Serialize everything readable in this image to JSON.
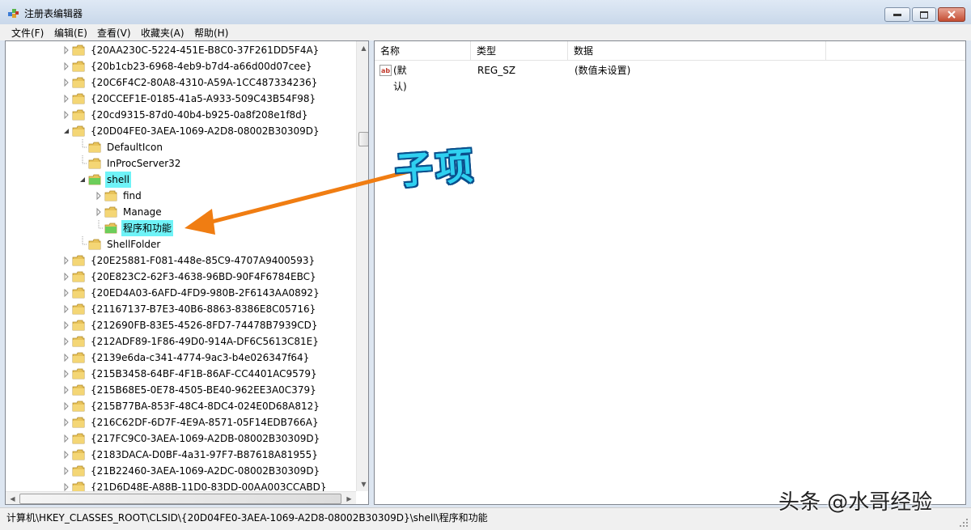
{
  "window": {
    "title": "注册表编辑器"
  },
  "menu": [
    {
      "id": "file",
      "label": "文件(F)"
    },
    {
      "id": "edit",
      "label": "编辑(E)"
    },
    {
      "id": "view",
      "label": "查看(V)"
    },
    {
      "id": "favorites",
      "label": "收藏夹(A)"
    },
    {
      "id": "help",
      "label": "帮助(H)"
    }
  ],
  "tree": [
    {
      "label": "{20AA230C-5224-451E-B8C0-37F261DD5F4A}",
      "expander": "collapsed"
    },
    {
      "label": "{20b1cb23-6968-4eb9-b7d4-a66d00d07cee}",
      "expander": "collapsed"
    },
    {
      "label": "{20C6F4C2-80A8-4310-A59A-1CC487334236}",
      "expander": "collapsed"
    },
    {
      "label": "{20CCEF1E-0185-41a5-A933-509C43B54F98}",
      "expander": "collapsed"
    },
    {
      "label": "{20cd9315-87d0-40b4-b925-0a8f208e1f8d}",
      "expander": "collapsed"
    },
    {
      "label": "{20D04FE0-3AEA-1069-A2D8-08002B30309D}",
      "expander": "expanded"
    },
    {
      "label": "DefaultIcon",
      "expander": "none",
      "level": 1
    },
    {
      "label": "InProcServer32",
      "expander": "none",
      "level": 1
    },
    {
      "label": "shell",
      "expander": "expanded",
      "level": 1,
      "highlight": true
    },
    {
      "label": "find",
      "expander": "collapsed",
      "level": 2
    },
    {
      "label": "Manage",
      "expander": "collapsed",
      "level": 2
    },
    {
      "label": "程序和功能",
      "expander": "none",
      "level": 2,
      "highlight": true,
      "selected": true
    },
    {
      "label": "ShellFolder",
      "expander": "none",
      "level": 1
    },
    {
      "label": "{20E25881-F081-448e-85C9-4707A9400593}",
      "expander": "collapsed"
    },
    {
      "label": "{20E823C2-62F3-4638-96BD-90F4F6784EBC}",
      "expander": "collapsed"
    },
    {
      "label": "{20ED4A03-6AFD-4FD9-980B-2F6143AA0892}",
      "expander": "collapsed"
    },
    {
      "label": "{21167137-B7E3-40B6-8863-8386E8C05716}",
      "expander": "collapsed"
    },
    {
      "label": "{212690FB-83E5-4526-8FD7-74478B7939CD}",
      "expander": "collapsed"
    },
    {
      "label": "{212ADF89-1F86-49D0-914A-DF6C5613C81E}",
      "expander": "collapsed"
    },
    {
      "label": "{2139e6da-c341-4774-9ac3-b4e026347f64}",
      "expander": "collapsed"
    },
    {
      "label": "{215B3458-64BF-4F1B-86AF-CC4401AC9579}",
      "expander": "collapsed"
    },
    {
      "label": "{215B68E5-0E78-4505-BE40-962EE3A0C379}",
      "expander": "collapsed"
    },
    {
      "label": "{215B77BA-853F-48C4-8DC4-024E0D68A812}",
      "expander": "collapsed"
    },
    {
      "label": "{216C62DF-6D7F-4E9A-8571-05F14EDB766A}",
      "expander": "collapsed"
    },
    {
      "label": "{217FC9C0-3AEA-1069-A2DB-08002B30309D}",
      "expander": "collapsed"
    },
    {
      "label": "{2183DACA-D0BF-4a31-97F7-B87618A81955}",
      "expander": "collapsed"
    },
    {
      "label": "{21B22460-3AEA-1069-A2DC-08002B30309D}",
      "expander": "collapsed"
    },
    {
      "label": "{21D6D48E-A88B-11D0-83DD-00AA003CCABD}",
      "expander": "collapsed"
    }
  ],
  "list": {
    "columns": [
      "名称",
      "类型",
      "数据"
    ],
    "rows": [
      {
        "name": "(默认)",
        "type": "REG_SZ",
        "data": "(数值未设置)",
        "icon": "string-value-icon"
      }
    ]
  },
  "status": {
    "path": "计算机\\HKEY_CLASSES_ROOT\\CLSID\\{20D04FE0-3AEA-1069-A2D8-08002B30309D}\\shell\\程序和功能"
  },
  "annotation": {
    "callout": "子项",
    "arrow_color": "#f07d12"
  },
  "watermark": "头条 @水哥经验",
  "colors": {
    "highlight": "#6ff3f7",
    "folder": "#e8c35a"
  }
}
